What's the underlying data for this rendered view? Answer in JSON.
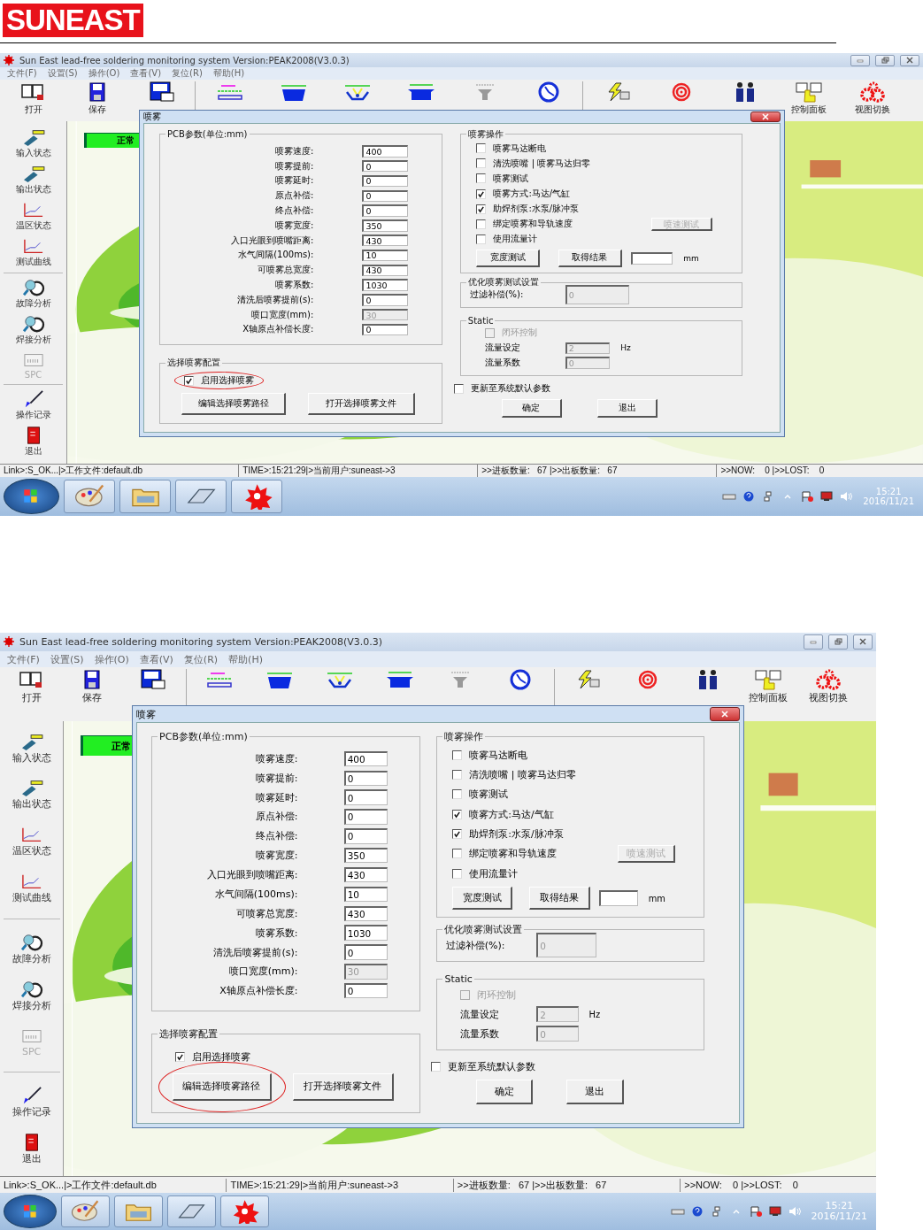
{
  "header": {
    "logo": "SUNEAST"
  },
  "screenshots": [
    {
      "title": "Sun East lead-free soldering monitoring system Version:PEAK2008(V3.0.3)",
      "menu": [
        "文件(F)",
        "设置(S)",
        "操作(O)",
        "查看(V)",
        "复位(R)",
        "帮助(H)"
      ],
      "toolbar": [
        {
          "kind": "open",
          "label": "打开"
        },
        {
          "kind": "save",
          "label": "保存"
        },
        {
          "kind": "disk"
        },
        {
          "kind": "sep"
        },
        {
          "kind": "lines"
        },
        {
          "kind": "tank"
        },
        {
          "kind": "spray"
        },
        {
          "kind": "pot"
        },
        {
          "kind": "nozzle"
        },
        {
          "kind": "clock"
        },
        {
          "kind": "sep"
        },
        {
          "kind": "bolt"
        },
        {
          "kind": "spiral"
        },
        {
          "kind": "people"
        },
        {
          "kind": "panel",
          "label": "控制面板"
        },
        {
          "kind": "gears",
          "label": "视图切换"
        }
      ],
      "sidebar": [
        {
          "kind": "probe",
          "label": "输入状态",
          "disabled": false
        },
        {
          "kind": "probe",
          "label": "输出状态",
          "disabled": false
        },
        {
          "kind": "chart",
          "label": "温区状态",
          "disabled": false
        },
        {
          "kind": "chart",
          "label": "测试曲线",
          "disabled": false
        },
        {
          "kind": "sep"
        },
        {
          "kind": "magnifier",
          "label": "故障分析",
          "disabled": false
        },
        {
          "kind": "magnifier",
          "label": "焊接分析",
          "disabled": false
        },
        {
          "kind": "spc",
          "label": "SPC",
          "disabled": true
        },
        {
          "kind": "sep"
        },
        {
          "kind": "brush",
          "label": "操作记录",
          "disabled": false
        },
        {
          "kind": "exit",
          "label": "退出",
          "disabled": false
        }
      ],
      "status_indicator": "正常",
      "dialog": {
        "title": "喷雾",
        "pcb_group": {
          "title": "PCB参数(单位:mm)",
          "rows": [
            {
              "label": "喷雾速度:",
              "value": "400",
              "disabled": false
            },
            {
              "label": "喷雾提前:",
              "value": "0",
              "disabled": false
            },
            {
              "label": "喷雾延时:",
              "value": "0",
              "disabled": false
            },
            {
              "label": "原点补偿:",
              "value": "0",
              "disabled": false
            },
            {
              "label": "终点补偿:",
              "value": "0",
              "disabled": false
            },
            {
              "label": "喷雾宽度:",
              "value": "350",
              "disabled": false
            },
            {
              "label": "入口光眼到喷嘴距离:",
              "value": "430",
              "disabled": false
            },
            {
              "label": "水气间隔(100ms):",
              "value": "10",
              "disabled": false
            },
            {
              "label": "可喷雾总宽度:",
              "value": "430",
              "disabled": false
            },
            {
              "label": "喷雾系数:",
              "value": "1030",
              "disabled": false
            },
            {
              "label": "清洗后喷雾提前(s):",
              "value": "0",
              "disabled": false
            },
            {
              "label": "喷口宽度(mm):",
              "value": "30",
              "disabled": true
            },
            {
              "label": "X轴原点补偿长度:",
              "value": "0",
              "disabled": false
            }
          ]
        },
        "select_group": {
          "title": "选择喷雾配置",
          "checkbox": {
            "label": "启用选择喷雾",
            "checked": true,
            "circled": true
          },
          "buttons": [
            {
              "label": "编辑选择喷雾路径",
              "circled": false
            },
            {
              "label": "打开选择喷雾文件",
              "circled": false
            }
          ]
        },
        "ops_group": {
          "title": "喷雾操作",
          "options": [
            {
              "label": "喷雾马达断电",
              "checked": false
            },
            {
              "label": "清洗喷嘴 | 喷雾马达归零",
              "checked": false
            },
            {
              "label": "喷雾测试",
              "checked": false
            },
            {
              "label": "喷雾方式:马达/气缸",
              "checked": true
            },
            {
              "label": "助焊剂泵:水泵/脉冲泵",
              "checked": true
            },
            {
              "label": "绑定喷雾和导轨速度",
              "checked": false
            },
            {
              "label": "使用流量计",
              "checked": false
            }
          ],
          "side_button": {
            "label": "喷速测试",
            "disabled": true
          },
          "width_test": "宽度测试",
          "get_result": "取得结果",
          "unit": "mm"
        },
        "optimize_group": {
          "title": "优化喷雾测试设置",
          "label": "过滤补偿(%):",
          "value": "0"
        },
        "static_group": {
          "title": "Static",
          "checkbox": {
            "label": "闭环控制",
            "checked": false,
            "disabled": true
          },
          "rows": [
            {
              "label": "流量设定",
              "value": "2",
              "unit": "Hz"
            },
            {
              "label": "流量系数",
              "value": "0"
            }
          ]
        },
        "reset_checkbox": {
          "label": "更新至系统默认参数",
          "checked": false
        },
        "buttons": [
          "确定",
          "退出"
        ]
      },
      "status_bar": [
        "Link>:S_OK...|>工作文件:default.db",
        "TIME>:15:21:29|>当前用户:suneast->3",
        ">>进板数量:   67 |>>出板数量:   67",
        ">>NOW:    0 |>>LOST:    0"
      ],
      "taskbar": {
        "apps": [
          {
            "kind": "paint"
          },
          {
            "kind": "folder"
          },
          {
            "kind": "eraser"
          },
          {
            "kind": "burst"
          }
        ],
        "time": "15:21",
        "date": "2016/11/21"
      }
    },
    {
      "title": "Sun East lead-free soldering monitoring system Version:PEAK2008(V3.0.3)",
      "menu": [
        "文件(F)",
        "设置(S)",
        "操作(O)",
        "查看(V)",
        "复位(R)",
        "帮助(H)"
      ],
      "toolbar": [
        {
          "kind": "open",
          "label": "打开"
        },
        {
          "kind": "save",
          "label": "保存"
        },
        {
          "kind": "disk"
        },
        {
          "kind": "sep"
        },
        {
          "kind": "lines"
        },
        {
          "kind": "tank"
        },
        {
          "kind": "spray"
        },
        {
          "kind": "pot"
        },
        {
          "kind": "nozzle"
        },
        {
          "kind": "clock"
        },
        {
          "kind": "sep"
        },
        {
          "kind": "bolt"
        },
        {
          "kind": "spiral"
        },
        {
          "kind": "people"
        },
        {
          "kind": "panel",
          "label": "控制面板"
        },
        {
          "kind": "gears",
          "label": "视图切换"
        }
      ],
      "sidebar": [
        {
          "kind": "probe",
          "label": "输入状态",
          "disabled": false
        },
        {
          "kind": "probe",
          "label": "输出状态",
          "disabled": false
        },
        {
          "kind": "chart",
          "label": "温区状态",
          "disabled": false
        },
        {
          "kind": "chart",
          "label": "测试曲线",
          "disabled": false
        },
        {
          "kind": "sep"
        },
        {
          "kind": "magnifier",
          "label": "故障分析",
          "disabled": false
        },
        {
          "kind": "magnifier",
          "label": "焊接分析",
          "disabled": false
        },
        {
          "kind": "spc",
          "label": "SPC",
          "disabled": true
        },
        {
          "kind": "sep"
        },
        {
          "kind": "brush",
          "label": "操作记录",
          "disabled": false
        },
        {
          "kind": "exit",
          "label": "退出",
          "disabled": false
        }
      ],
      "status_indicator": "正常",
      "dialog": {
        "title": "喷雾",
        "pcb_group": {
          "title": "PCB参数(单位:mm)",
          "rows": [
            {
              "label": "喷雾速度:",
              "value": "400",
              "disabled": false
            },
            {
              "label": "喷雾提前:",
              "value": "0",
              "disabled": false
            },
            {
              "label": "喷雾延时:",
              "value": "0",
              "disabled": false
            },
            {
              "label": "原点补偿:",
              "value": "0",
              "disabled": false
            },
            {
              "label": "终点补偿:",
              "value": "0",
              "disabled": false
            },
            {
              "label": "喷雾宽度:",
              "value": "350",
              "disabled": false
            },
            {
              "label": "入口光眼到喷嘴距离:",
              "value": "430",
              "disabled": false
            },
            {
              "label": "水气间隔(100ms):",
              "value": "10",
              "disabled": false
            },
            {
              "label": "可喷雾总宽度:",
              "value": "430",
              "disabled": false
            },
            {
              "label": "喷雾系数:",
              "value": "1030",
              "disabled": false
            },
            {
              "label": "清洗后喷雾提前(s):",
              "value": "0",
              "disabled": false
            },
            {
              "label": "喷口宽度(mm):",
              "value": "30",
              "disabled": true
            },
            {
              "label": "X轴原点补偿长度:",
              "value": "0",
              "disabled": false
            }
          ]
        },
        "select_group": {
          "title": "选择喷雾配置",
          "checkbox": {
            "label": "启用选择喷雾",
            "checked": true,
            "circled": false
          },
          "buttons": [
            {
              "label": "编辑选择喷雾路径",
              "circled": true
            },
            {
              "label": "打开选择喷雾文件",
              "circled": false
            }
          ]
        },
        "ops_group": {
          "title": "喷雾操作",
          "options": [
            {
              "label": "喷雾马达断电",
              "checked": false
            },
            {
              "label": "清洗喷嘴 | 喷雾马达归零",
              "checked": false
            },
            {
              "label": "喷雾测试",
              "checked": false
            },
            {
              "label": "喷雾方式:马达/气缸",
              "checked": true
            },
            {
              "label": "助焊剂泵:水泵/脉冲泵",
              "checked": true
            },
            {
              "label": "绑定喷雾和导轨速度",
              "checked": false
            },
            {
              "label": "使用流量计",
              "checked": false
            }
          ],
          "side_button": {
            "label": "喷速测试",
            "disabled": true
          },
          "width_test": "宽度测试",
          "get_result": "取得结果",
          "unit": "mm"
        },
        "optimize_group": {
          "title": "优化喷雾测试设置",
          "label": "过滤补偿(%):",
          "value": "0"
        },
        "static_group": {
          "title": "Static",
          "checkbox": {
            "label": "闭环控制",
            "checked": false,
            "disabled": true
          },
          "rows": [
            {
              "label": "流量设定",
              "value": "2",
              "unit": "Hz"
            },
            {
              "label": "流量系数",
              "value": "0"
            }
          ]
        },
        "reset_checkbox": {
          "label": "更新至系统默认参数",
          "checked": false
        },
        "buttons": [
          "确定",
          "退出"
        ]
      },
      "status_bar": [
        "Link>:S_OK...|>工作文件:default.db",
        "TIME>:15:21:29|>当前用户:suneast->3",
        ">>进板数量:   67 |>>出板数量:   67",
        ">>NOW:    0 |>>LOST:    0"
      ],
      "taskbar": {
        "apps": [
          {
            "kind": "paint"
          },
          {
            "kind": "folder"
          },
          {
            "kind": "eraser"
          },
          {
            "kind": "burst"
          }
        ],
        "time": "15:21",
        "date": "2016/11/21"
      }
    }
  ]
}
